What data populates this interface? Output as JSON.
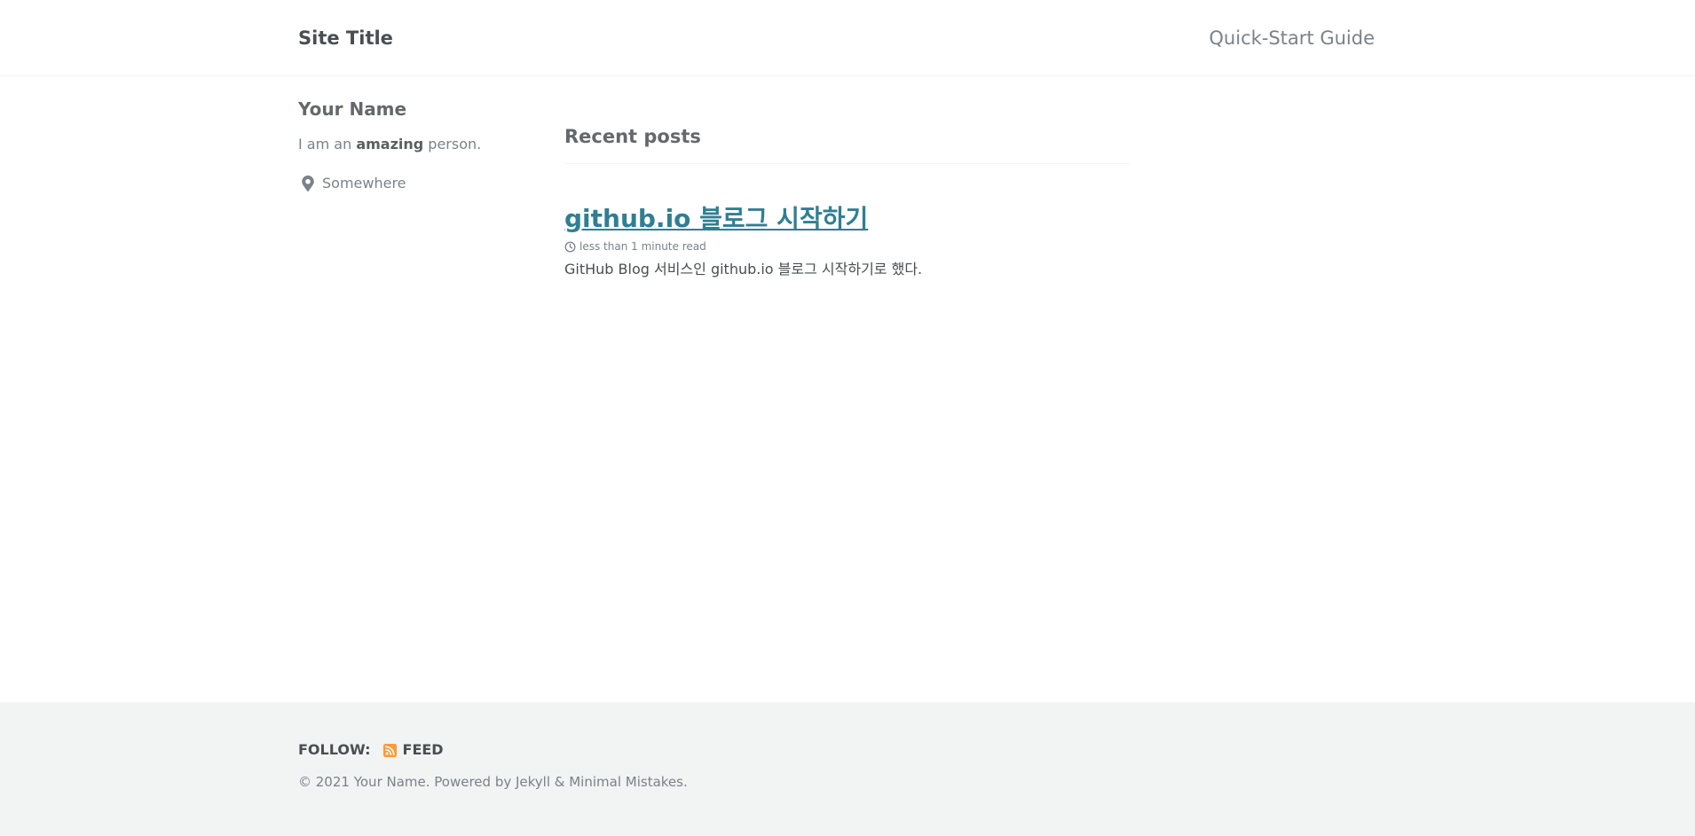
{
  "masthead": {
    "site_title": "Site Title",
    "nav_link": "Quick-Start Guide"
  },
  "sidebar": {
    "author_name": "Your Name",
    "bio_prefix": "I am an ",
    "bio_bold": "amazing",
    "bio_suffix": " person.",
    "location": "Somewhere",
    "location_icon": "map-marker-icon"
  },
  "main": {
    "section_title": "Recent posts",
    "posts": [
      {
        "title": "github.io 블로그 시작하기",
        "read_time": "less than 1 minute read",
        "excerpt": "GitHub Blog 서비스인 github.io 블로그 시작하기로 했다."
      }
    ]
  },
  "footer": {
    "follow_label": "FOLLOW:",
    "feed_label": "FEED",
    "feed_icon": "rss-icon",
    "copyright": "© 2021 Your Name. Powered by Jekyll & Minimal Mistakes."
  },
  "colors": {
    "link": "#2f7f93",
    "text": "#494e52",
    "muted": "#7a8288",
    "footer_bg": "#f2f3f3",
    "rss": "#fa9b39"
  }
}
